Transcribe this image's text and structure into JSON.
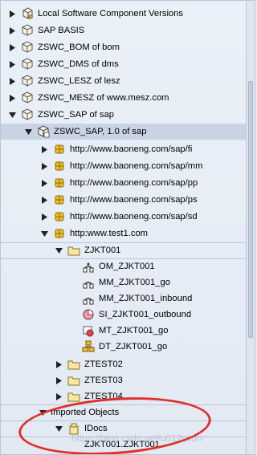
{
  "tree": {
    "items": [
      {
        "label": "Local Software Component Versions"
      },
      {
        "label": "SAP BASIS"
      },
      {
        "label": "ZSWC_BOM of bom"
      },
      {
        "label": "ZSWC_DMS of dms"
      },
      {
        "label": "ZSWC_LESZ of lesz"
      },
      {
        "label": "ZSWC_MESZ of www.mesz.com"
      },
      {
        "label": "ZSWC_SAP of sap"
      },
      {
        "label": "ZSWC_SAP, 1.0 of sap"
      },
      {
        "label": "http://www.baoneng.com/sap/fi"
      },
      {
        "label": "http://www.baoneng.com/sap/mm"
      },
      {
        "label": "http://www.baoneng.com/sap/pp"
      },
      {
        "label": "http://www.baoneng.com/sap/ps"
      },
      {
        "label": "http://www.baoneng.com/sap/sd"
      },
      {
        "label": "http:www.test1.com"
      },
      {
        "label": "ZJKT001"
      },
      {
        "label": "OM_ZJKT001"
      },
      {
        "label": "MM_ZJKT001_go"
      },
      {
        "label": "MM_ZJKT001_inbound"
      },
      {
        "label": "SI_ZJKT001_outbound"
      },
      {
        "label": "MT_ZJKT001_go"
      },
      {
        "label": "DT_ZJKT001_go"
      },
      {
        "label": "ZTEST02"
      },
      {
        "label": "ZTEST03"
      },
      {
        "label": "ZTEST04"
      },
      {
        "label": "Imported Objects"
      },
      {
        "label": "IDocs"
      },
      {
        "label": "ZJKT001.ZJKT001"
      }
    ]
  },
  "watermark": "https://blog.csdn.net/u012csdn",
  "colors": {
    "annotation": "#e0302a",
    "selection": "#c8d4e3"
  }
}
